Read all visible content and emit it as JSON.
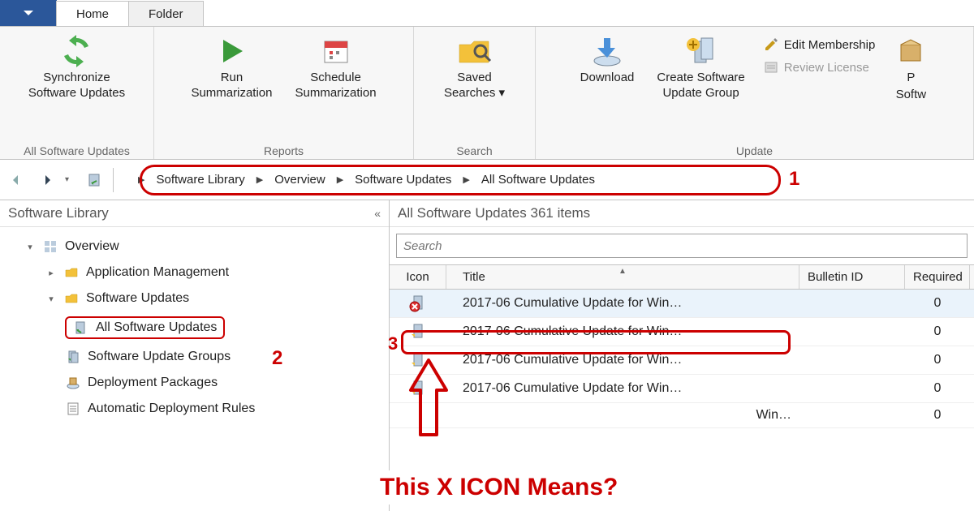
{
  "tabs": {
    "home": "Home",
    "folder": "Folder"
  },
  "ribbon": {
    "sync": "Synchronize\nSoftware Updates",
    "run_sum": "Run\nSummarization",
    "sched_sum": "Schedule\nSummarization",
    "saved_search": "Saved\nSearches ▾",
    "download": "Download",
    "create_group": "Create Software\nUpdate Group",
    "edit_membership": "Edit Membership",
    "review_license": "Review License",
    "p_softw_top": "P",
    "p_softw_bottom": "Softw",
    "group_updates": "All Software Updates",
    "group_reports": "Reports",
    "group_search": "Search",
    "group_update": "Update"
  },
  "breadcrumb": [
    "Software Library",
    "Overview",
    "Software Updates",
    "All Software Updates"
  ],
  "sidebar": {
    "title": "Software Library",
    "items": {
      "overview": "Overview",
      "app_mgmt": "Application Management",
      "sw_updates": "Software Updates",
      "all_sw": "All Software Updates",
      "sw_groups": "Software Update Groups",
      "deploy_pkg": "Deployment Packages",
      "auto_rules": "Automatic Deployment Rules"
    }
  },
  "content": {
    "header_label": "All Software Updates",
    "header_count": "361 items",
    "search_placeholder": "Search",
    "columns": {
      "icon": "Icon",
      "title": "Title",
      "bulletin": "Bulletin ID",
      "required": "Required"
    },
    "rows": [
      {
        "title": "2017-06 Cumulative Update for Win…",
        "required": "0",
        "x": true
      },
      {
        "title": "2017-06 Cumulative Update for Win…",
        "required": "0",
        "x": false
      },
      {
        "title": "2017-06 Cumulative Update for Win…",
        "required": "0",
        "x": false
      },
      {
        "title": "2017-06 Cumulative Update for Win…",
        "required": "0",
        "x": false
      },
      {
        "title": "Win…",
        "required": "0",
        "x": false
      }
    ]
  },
  "annotations": {
    "n1": "1",
    "n2": "2",
    "n3": "3",
    "caption": "This X ICON Means?"
  }
}
